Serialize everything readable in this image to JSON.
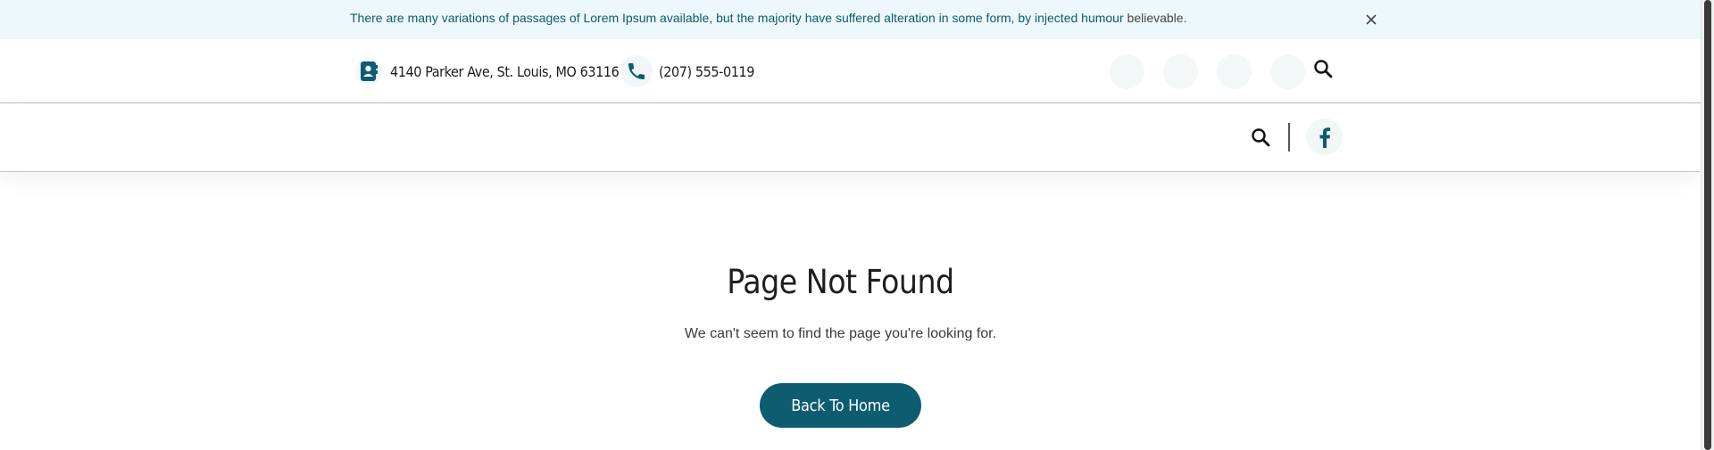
{
  "announcement": {
    "text_main": "There are many variations of passages of Lorem Ipsum available, but the majority have suffered alteration in some form, by injected humour",
    "text_tail": " believable."
  },
  "contact": {
    "address": "4140 Parker Ave, St. Louis, MO 63116",
    "phone": "(207) 555-0119"
  },
  "main": {
    "title": "Page Not Found",
    "subtitle": "We can't seem to find the page you're looking for.",
    "button_label": "Back To Home"
  },
  "icons": {
    "close": "close-icon",
    "address": "address-card-icon",
    "phone": "phone-icon",
    "search": "search-icon",
    "facebook": "facebook-icon"
  },
  "colors": {
    "brand": "#0d5c70",
    "announcement_bg": "#ecf8fb",
    "announcement_text": "#0f5a6d"
  }
}
